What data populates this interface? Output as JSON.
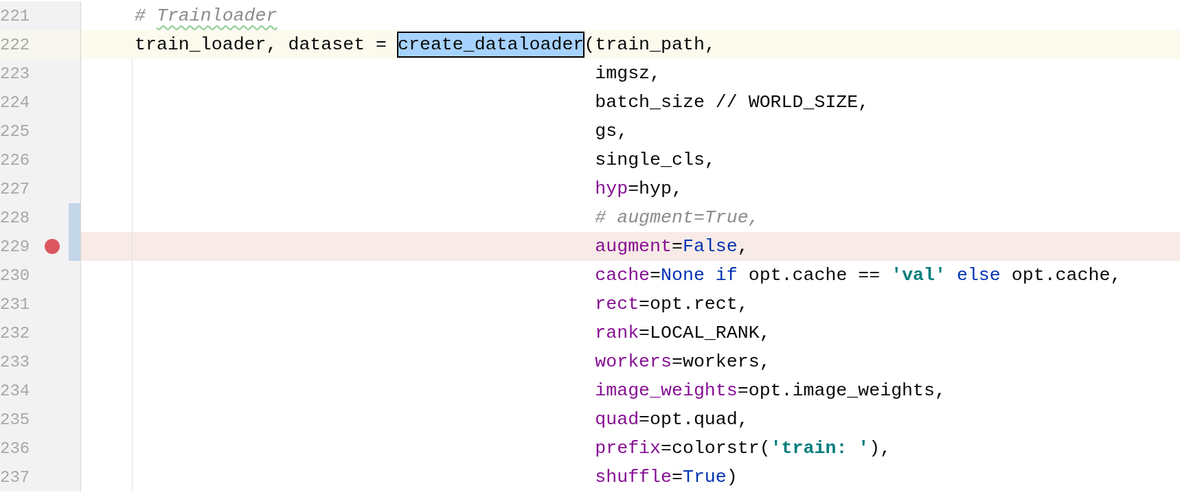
{
  "editor": {
    "lines": [
      {
        "number": "221",
        "aligned": false,
        "current": false,
        "breakpoint": false,
        "changed": false,
        "tokens": [
          {
            "text": "# ",
            "kind": "comment"
          },
          {
            "text": "Trainloader",
            "kind": "comment-typo"
          }
        ]
      },
      {
        "number": "222",
        "aligned": false,
        "current": true,
        "breakpoint": false,
        "changed": false,
        "tokens": [
          {
            "text": "train_loader, dataset = ",
            "kind": "plain"
          },
          {
            "text": "create_dataloader",
            "kind": "usage-highlight"
          },
          {
            "text": "(train_path,",
            "kind": "plain"
          }
        ]
      },
      {
        "number": "223",
        "aligned": true,
        "current": false,
        "breakpoint": false,
        "changed": false,
        "tokens": [
          {
            "text": "imgsz,",
            "kind": "plain"
          }
        ]
      },
      {
        "number": "224",
        "aligned": true,
        "current": false,
        "breakpoint": false,
        "changed": false,
        "tokens": [
          {
            "text": "batch_size // WORLD_SIZE,",
            "kind": "plain"
          }
        ]
      },
      {
        "number": "225",
        "aligned": true,
        "current": false,
        "breakpoint": false,
        "changed": false,
        "tokens": [
          {
            "text": "gs,",
            "kind": "plain"
          }
        ]
      },
      {
        "number": "226",
        "aligned": true,
        "current": false,
        "breakpoint": false,
        "changed": false,
        "tokens": [
          {
            "text": "single_cls,",
            "kind": "plain"
          }
        ]
      },
      {
        "number": "227",
        "aligned": true,
        "current": false,
        "breakpoint": false,
        "changed": false,
        "tokens": [
          {
            "text": "hyp",
            "kind": "param"
          },
          {
            "text": "=hyp,",
            "kind": "plain"
          }
        ]
      },
      {
        "number": "228",
        "aligned": true,
        "current": false,
        "breakpoint": false,
        "changed": true,
        "tokens": [
          {
            "text": "# augment=True,",
            "kind": "comment"
          }
        ]
      },
      {
        "number": "229",
        "aligned": true,
        "current": false,
        "breakpoint": true,
        "changed": true,
        "tokens": [
          {
            "text": "augment",
            "kind": "param"
          },
          {
            "text": "=",
            "kind": "plain"
          },
          {
            "text": "False",
            "kind": "literal"
          },
          {
            "text": ",",
            "kind": "plain"
          }
        ]
      },
      {
        "number": "230",
        "aligned": true,
        "current": false,
        "breakpoint": false,
        "changed": false,
        "tokens": [
          {
            "text": "cache",
            "kind": "param"
          },
          {
            "text": "=",
            "kind": "plain"
          },
          {
            "text": "None",
            "kind": "literal"
          },
          {
            "text": " if ",
            "kind": "keyword"
          },
          {
            "text": "opt.cache == ",
            "kind": "plain"
          },
          {
            "text": "'val'",
            "kind": "string"
          },
          {
            "text": " else ",
            "kind": "keyword"
          },
          {
            "text": "opt.cache,",
            "kind": "plain"
          }
        ]
      },
      {
        "number": "231",
        "aligned": true,
        "current": false,
        "breakpoint": false,
        "changed": false,
        "tokens": [
          {
            "text": "rect",
            "kind": "param"
          },
          {
            "text": "=opt.rect,",
            "kind": "plain"
          }
        ]
      },
      {
        "number": "232",
        "aligned": true,
        "current": false,
        "breakpoint": false,
        "changed": false,
        "tokens": [
          {
            "text": "rank",
            "kind": "param"
          },
          {
            "text": "=LOCAL_RANK,",
            "kind": "plain"
          }
        ]
      },
      {
        "number": "233",
        "aligned": true,
        "current": false,
        "breakpoint": false,
        "changed": false,
        "tokens": [
          {
            "text": "workers",
            "kind": "param"
          },
          {
            "text": "=workers,",
            "kind": "plain"
          }
        ]
      },
      {
        "number": "234",
        "aligned": true,
        "current": false,
        "breakpoint": false,
        "changed": false,
        "tokens": [
          {
            "text": "image_weights",
            "kind": "param"
          },
          {
            "text": "=opt.image_weights,",
            "kind": "plain"
          }
        ]
      },
      {
        "number": "235",
        "aligned": true,
        "current": false,
        "breakpoint": false,
        "changed": false,
        "tokens": [
          {
            "text": "quad",
            "kind": "param"
          },
          {
            "text": "=opt.quad,",
            "kind": "plain"
          }
        ]
      },
      {
        "number": "236",
        "aligned": true,
        "current": false,
        "breakpoint": false,
        "changed": false,
        "tokens": [
          {
            "text": "prefix",
            "kind": "param"
          },
          {
            "text": "=colorstr(",
            "kind": "plain"
          },
          {
            "text": "'train: '",
            "kind": "string"
          },
          {
            "text": "),",
            "kind": "plain"
          }
        ]
      },
      {
        "number": "237",
        "aligned": true,
        "current": false,
        "breakpoint": false,
        "changed": false,
        "tokens": [
          {
            "text": "shuffle",
            "kind": "param"
          },
          {
            "text": "=",
            "kind": "plain"
          },
          {
            "text": "True",
            "kind": "literal"
          },
          {
            "text": ")",
            "kind": "plain"
          }
        ]
      }
    ]
  }
}
